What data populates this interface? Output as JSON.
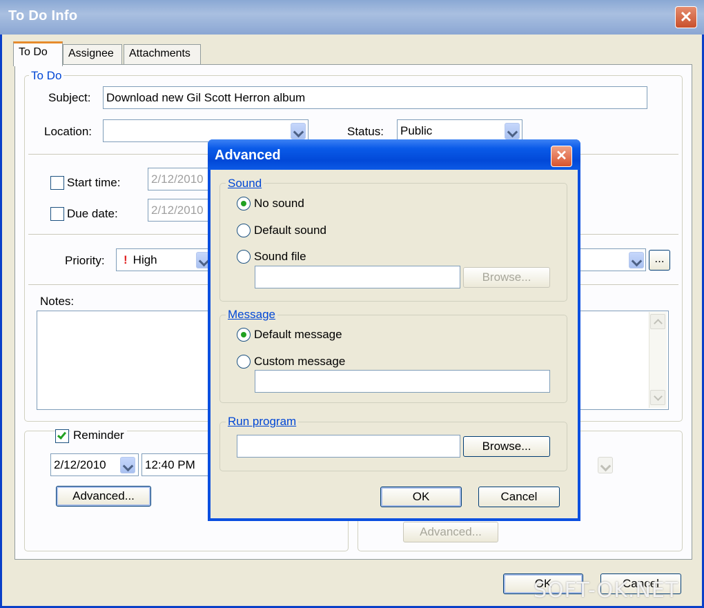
{
  "window": {
    "title": "To Do Info",
    "close_glyph": "✕"
  },
  "tabs": [
    {
      "label": "To Do",
      "active": true
    },
    {
      "label": "Assignee",
      "active": false
    },
    {
      "label": "Attachments",
      "active": false
    }
  ],
  "todo": {
    "group_label": "To Do",
    "subject_label": "Subject:",
    "subject_value": "Download new Gil Scott Herron album",
    "location_label": "Location:",
    "location_value": "",
    "status_label": "Status:",
    "status_value": "Public",
    "start_time_label": "Start time:",
    "start_time_value": "2/12/2010",
    "start_time_checked": false,
    "due_date_label": "Due date:",
    "due_date_value": "2/12/2010",
    "due_date_checked": false,
    "priority_label": "Priority:",
    "priority_icon": "!",
    "priority_value": "High",
    "more_button": "...",
    "notes_label": "Notes:",
    "notes_value": ""
  },
  "reminder": {
    "label": "Reminder",
    "checked": true,
    "date": "2/12/2010",
    "time": "12:40 PM",
    "advanced_button": "Advanced..."
  },
  "right_panel": {
    "advanced_button": "Advanced..."
  },
  "footer": {
    "ok": "OK",
    "cancel": "Cancel"
  },
  "watermark": "SOFT-OK.NET",
  "dialog": {
    "title": "Advanced",
    "close_glyph": "✕",
    "sound": {
      "group_label": "Sound",
      "options": [
        {
          "label": "No sound",
          "selected": true
        },
        {
          "label": "Default sound",
          "selected": false
        },
        {
          "label": "Sound file",
          "selected": false
        }
      ],
      "file_value": "",
      "browse_button": "Browse..."
    },
    "message": {
      "group_label": "Message",
      "options": [
        {
          "label": "Default message",
          "selected": true
        },
        {
          "label": "Custom message",
          "selected": false
        }
      ],
      "custom_value": ""
    },
    "run_program": {
      "group_label": "Run program",
      "value": "",
      "browse_button": "Browse..."
    },
    "ok": "OK",
    "cancel": "Cancel"
  },
  "colors": {
    "accent_blue": "#0046d5",
    "dialog_title_blue": "#0249d8",
    "close_red": "#c9502c",
    "check_green": "#21a121",
    "priority_red": "#e02020",
    "face": "#ece9d8"
  }
}
